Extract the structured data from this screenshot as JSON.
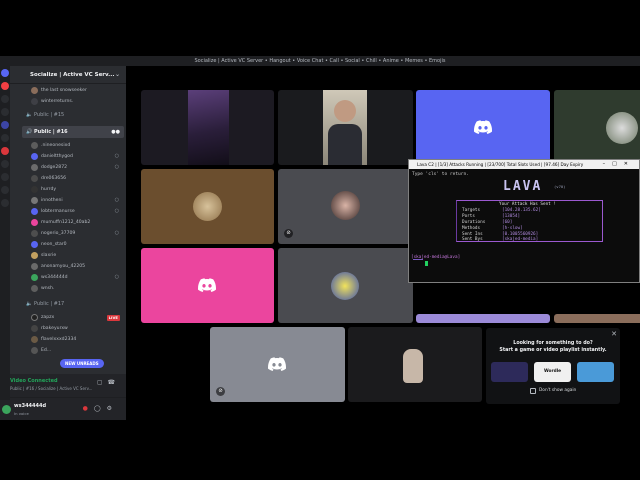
{
  "window": {
    "title": "Socialize | Active VC Server • Hangout • Voice Chat • Call • Social • Chill • Anime • Memes • Emojis"
  },
  "server": {
    "name": "Socialize | Active VC Serv..."
  },
  "members_top": [
    {
      "name": "the last snowseeker"
    },
    {
      "name": "winterreturns."
    }
  ],
  "channels": {
    "public15": "Public | #15",
    "public16": "Public | #16",
    "public17": "Public | #17"
  },
  "members_16": [
    {
      "name": ".nineonesixd"
    },
    {
      "name": "danieltthygod"
    },
    {
      "name": "dodge2872"
    },
    {
      "name": "dre063656"
    },
    {
      "name": "hurrdy"
    },
    {
      "name": "innotheni"
    },
    {
      "name": "lobtermanurse"
    },
    {
      "name": "mumuffn1212_40ab2"
    },
    {
      "name": "nogerio_37709"
    },
    {
      "name": "neon_star0"
    },
    {
      "name": "slaxrie"
    },
    {
      "name": "anonamyou_42205"
    },
    {
      "name": "ws344444d"
    },
    {
      "name": "wnsh."
    }
  ],
  "members_17": [
    {
      "name": "zapzx",
      "badge": "LIVE"
    },
    {
      "name": "rbakeyurxw"
    },
    {
      "name": "flavelxxxd2334"
    },
    {
      "name": "Ed..."
    }
  ],
  "new_unreads": "NEW UNREADS",
  "voice": {
    "status": "Video Connected",
    "location": "Public | #16 / Socialize | Active VC Serv..."
  },
  "user": {
    "name": "ws344444d",
    "status": "In voice"
  },
  "lava": {
    "window_title": "Lava C2   |   [1/3] Attacks Running   |   [23/700] Total Slots Used   |   [97.46] Day Expiry",
    "hint": "Type 'cls' to return.",
    "logo": "LAVA",
    "version": "(v70)",
    "panel_title": "Your Attack Has Sent !",
    "fields": [
      {
        "key": "Targets",
        "value": "[104.28.135.62]"
      },
      {
        "key": "Ports",
        "value": "[13054]"
      },
      {
        "key": "Durations",
        "value": "[60]"
      },
      {
        "key": "Methods",
        "value": "[h-slow]"
      },
      {
        "key": "Sent Ins",
        "value": "[0.1005560926]"
      },
      {
        "key": "Sent Bys",
        "value": "[skajed-media]"
      }
    ],
    "prompt": "[skajed-media@Lava]"
  },
  "promo": {
    "line1": "Looking for something to do?",
    "line2": "Start a game or video playlist instantly.",
    "games": [
      {
        "name": "",
        "color": "#2d2a5a"
      },
      {
        "name": "Wordle",
        "color": "#f0f0f0"
      },
      {
        "name": "",
        "color": "#4a9ad8"
      }
    ],
    "dont_show": "Don't show again"
  },
  "colors": {
    "blurple": "#5865f2",
    "pink": "#eb459e",
    "brown": "#6b4e2e",
    "grey_tile": "#4a4b50",
    "live_red": "#da373c",
    "voice_green": "#23a55a"
  }
}
